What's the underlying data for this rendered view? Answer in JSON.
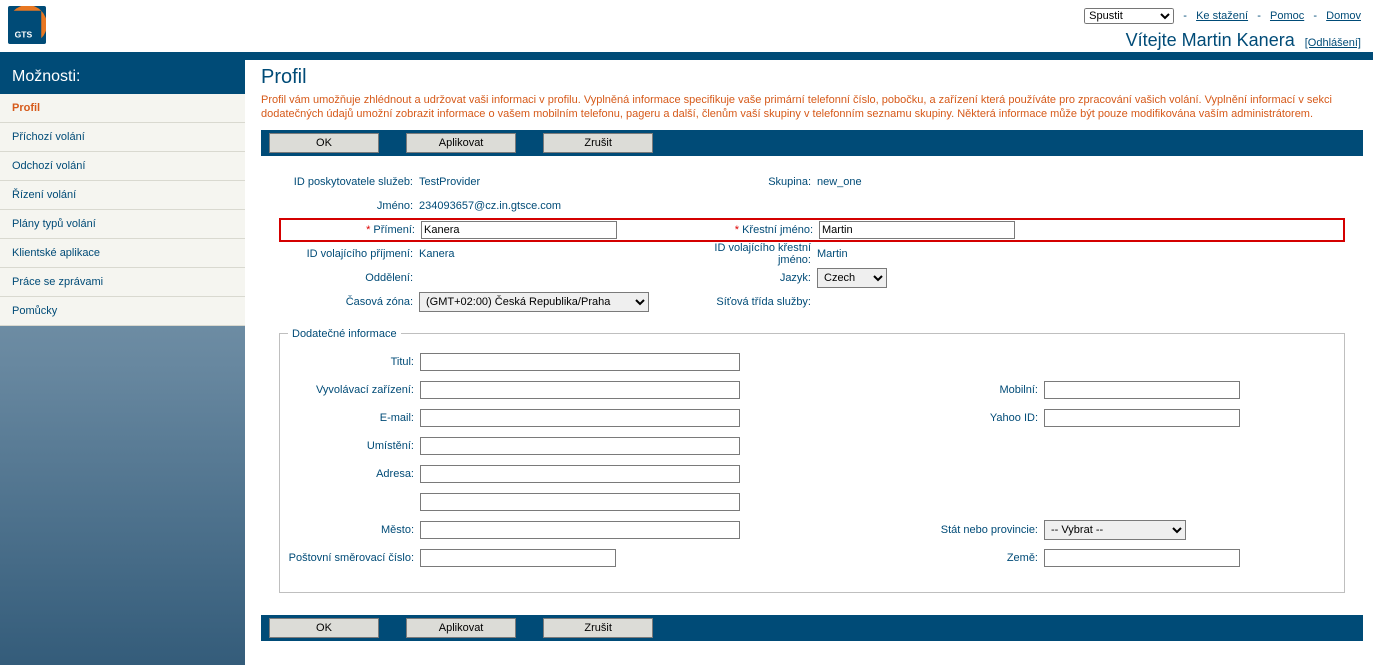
{
  "top": {
    "launch_selected": "Spustit",
    "link_download": "Ke stažení",
    "link_help": "Pomoc",
    "link_home": "Domov",
    "sep": "-",
    "welcome_prefix": "Vítejte ",
    "welcome_name": "Martin Kanera",
    "logout": "[Odhlášení]"
  },
  "sidebar": {
    "header": "Možnosti:",
    "items": [
      {
        "label": "Profil",
        "active": true
      },
      {
        "label": "Příchozí volání"
      },
      {
        "label": "Odchozí volání"
      },
      {
        "label": "Řízení volání"
      },
      {
        "label": "Plány typů volání"
      },
      {
        "label": "Klientské aplikace"
      },
      {
        "label": "Práce se zprávami"
      },
      {
        "label": "Pomůcky"
      }
    ]
  },
  "page": {
    "title": "Profil",
    "intro": "Profil vám umožňuje zhlédnout a udržovat vaši informaci v profilu. Vyplněná informace specifikuje vaše primární telefonní číslo, pobočku, a zařízení která používáte pro zpracování vašich volání. Vyplnění informací v sekci dodatečných údajů umožní zobrazit informace o vašem mobilním telefonu, pageru a další, členům vaší skupiny v telefonním seznamu skupiny. Některá informace může být pouze modifikována vaším administrátorem."
  },
  "buttons": {
    "ok": "OK",
    "apply": "Aplikovat",
    "cancel": "Zrušit"
  },
  "form": {
    "provider_label": "ID poskytovatele služeb:",
    "provider_value": "TestProvider",
    "group_label": "Skupina:",
    "group_value": "new_one",
    "username_label": "Jméno:",
    "username_value": "234093657@cz.in.gtsce.com",
    "lastname_label": "Přímení:",
    "lastname_value": "Kanera",
    "firstname_label": "Křestní jméno:",
    "firstname_value": "Martin",
    "clid_last_label": "ID volajícího příjmení:",
    "clid_last_value": "Kanera",
    "clid_first_label": "ID volajícího křestní jméno:",
    "clid_first_value": "Martin",
    "dept_label": "Oddělení:",
    "lang_label": "Jazyk:",
    "lang_value": "Czech",
    "tz_label": "Časová zóna:",
    "tz_value": "(GMT+02:00) Česká Republika/Praha",
    "netclass_label": "Síťová třída služby:"
  },
  "addl": {
    "legend": "Dodatečné informace",
    "title_label": "Titul:",
    "pager_label": "Vyvolávací zařízení:",
    "mobile_label": "Mobilní:",
    "email_label": "E-mail:",
    "yahoo_label": "Yahoo ID:",
    "location_label": "Umístění:",
    "address_label": "Adresa:",
    "city_label": "Město:",
    "state_label": "Stát nebo provincie:",
    "state_value": "-- Vybrat --",
    "zip_label": "Poštovní směrovací číslo:",
    "country_label": "Země:"
  }
}
